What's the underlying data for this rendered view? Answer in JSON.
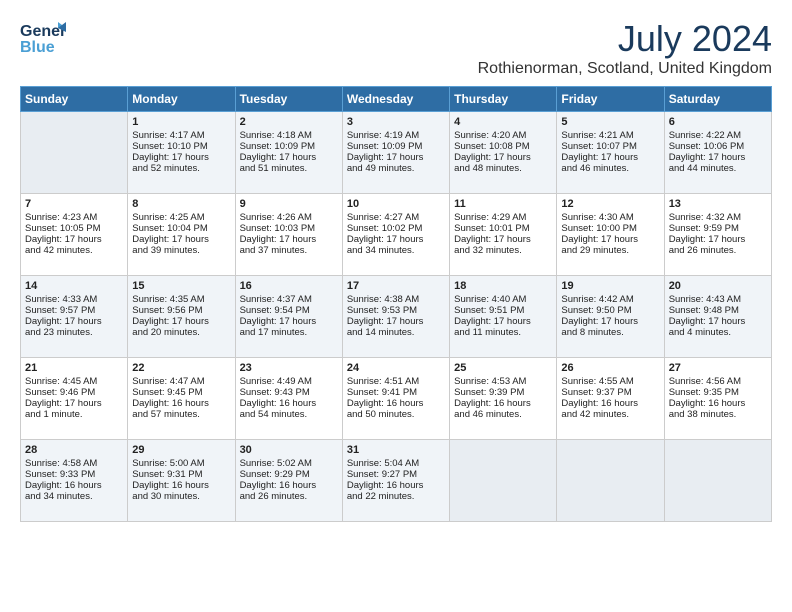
{
  "logo": {
    "line1": "General",
    "line2": "Blue"
  },
  "title": "July 2024",
  "location": "Rothienorman, Scotland, United Kingdom",
  "headers": [
    "Sunday",
    "Monday",
    "Tuesday",
    "Wednesday",
    "Thursday",
    "Friday",
    "Saturday"
  ],
  "weeks": [
    [
      {
        "day": "",
        "lines": []
      },
      {
        "day": "1",
        "lines": [
          "Sunrise: 4:17 AM",
          "Sunset: 10:10 PM",
          "Daylight: 17 hours",
          "and 52 minutes."
        ]
      },
      {
        "day": "2",
        "lines": [
          "Sunrise: 4:18 AM",
          "Sunset: 10:09 PM",
          "Daylight: 17 hours",
          "and 51 minutes."
        ]
      },
      {
        "day": "3",
        "lines": [
          "Sunrise: 4:19 AM",
          "Sunset: 10:09 PM",
          "Daylight: 17 hours",
          "and 49 minutes."
        ]
      },
      {
        "day": "4",
        "lines": [
          "Sunrise: 4:20 AM",
          "Sunset: 10:08 PM",
          "Daylight: 17 hours",
          "and 48 minutes."
        ]
      },
      {
        "day": "5",
        "lines": [
          "Sunrise: 4:21 AM",
          "Sunset: 10:07 PM",
          "Daylight: 17 hours",
          "and 46 minutes."
        ]
      },
      {
        "day": "6",
        "lines": [
          "Sunrise: 4:22 AM",
          "Sunset: 10:06 PM",
          "Daylight: 17 hours",
          "and 44 minutes."
        ]
      }
    ],
    [
      {
        "day": "7",
        "lines": [
          "Sunrise: 4:23 AM",
          "Sunset: 10:05 PM",
          "Daylight: 17 hours",
          "and 42 minutes."
        ]
      },
      {
        "day": "8",
        "lines": [
          "Sunrise: 4:25 AM",
          "Sunset: 10:04 PM",
          "Daylight: 17 hours",
          "and 39 minutes."
        ]
      },
      {
        "day": "9",
        "lines": [
          "Sunrise: 4:26 AM",
          "Sunset: 10:03 PM",
          "Daylight: 17 hours",
          "and 37 minutes."
        ]
      },
      {
        "day": "10",
        "lines": [
          "Sunrise: 4:27 AM",
          "Sunset: 10:02 PM",
          "Daylight: 17 hours",
          "and 34 minutes."
        ]
      },
      {
        "day": "11",
        "lines": [
          "Sunrise: 4:29 AM",
          "Sunset: 10:01 PM",
          "Daylight: 17 hours",
          "and 32 minutes."
        ]
      },
      {
        "day": "12",
        "lines": [
          "Sunrise: 4:30 AM",
          "Sunset: 10:00 PM",
          "Daylight: 17 hours",
          "and 29 minutes."
        ]
      },
      {
        "day": "13",
        "lines": [
          "Sunrise: 4:32 AM",
          "Sunset: 9:59 PM",
          "Daylight: 17 hours",
          "and 26 minutes."
        ]
      }
    ],
    [
      {
        "day": "14",
        "lines": [
          "Sunrise: 4:33 AM",
          "Sunset: 9:57 PM",
          "Daylight: 17 hours",
          "and 23 minutes."
        ]
      },
      {
        "day": "15",
        "lines": [
          "Sunrise: 4:35 AM",
          "Sunset: 9:56 PM",
          "Daylight: 17 hours",
          "and 20 minutes."
        ]
      },
      {
        "day": "16",
        "lines": [
          "Sunrise: 4:37 AM",
          "Sunset: 9:54 PM",
          "Daylight: 17 hours",
          "and 17 minutes."
        ]
      },
      {
        "day": "17",
        "lines": [
          "Sunrise: 4:38 AM",
          "Sunset: 9:53 PM",
          "Daylight: 17 hours",
          "and 14 minutes."
        ]
      },
      {
        "day": "18",
        "lines": [
          "Sunrise: 4:40 AM",
          "Sunset: 9:51 PM",
          "Daylight: 17 hours",
          "and 11 minutes."
        ]
      },
      {
        "day": "19",
        "lines": [
          "Sunrise: 4:42 AM",
          "Sunset: 9:50 PM",
          "Daylight: 17 hours",
          "and 8 minutes."
        ]
      },
      {
        "day": "20",
        "lines": [
          "Sunrise: 4:43 AM",
          "Sunset: 9:48 PM",
          "Daylight: 17 hours",
          "and 4 minutes."
        ]
      }
    ],
    [
      {
        "day": "21",
        "lines": [
          "Sunrise: 4:45 AM",
          "Sunset: 9:46 PM",
          "Daylight: 17 hours",
          "and 1 minute."
        ]
      },
      {
        "day": "22",
        "lines": [
          "Sunrise: 4:47 AM",
          "Sunset: 9:45 PM",
          "Daylight: 16 hours",
          "and 57 minutes."
        ]
      },
      {
        "day": "23",
        "lines": [
          "Sunrise: 4:49 AM",
          "Sunset: 9:43 PM",
          "Daylight: 16 hours",
          "and 54 minutes."
        ]
      },
      {
        "day": "24",
        "lines": [
          "Sunrise: 4:51 AM",
          "Sunset: 9:41 PM",
          "Daylight: 16 hours",
          "and 50 minutes."
        ]
      },
      {
        "day": "25",
        "lines": [
          "Sunrise: 4:53 AM",
          "Sunset: 9:39 PM",
          "Daylight: 16 hours",
          "and 46 minutes."
        ]
      },
      {
        "day": "26",
        "lines": [
          "Sunrise: 4:55 AM",
          "Sunset: 9:37 PM",
          "Daylight: 16 hours",
          "and 42 minutes."
        ]
      },
      {
        "day": "27",
        "lines": [
          "Sunrise: 4:56 AM",
          "Sunset: 9:35 PM",
          "Daylight: 16 hours",
          "and 38 minutes."
        ]
      }
    ],
    [
      {
        "day": "28",
        "lines": [
          "Sunrise: 4:58 AM",
          "Sunset: 9:33 PM",
          "Daylight: 16 hours",
          "and 34 minutes."
        ]
      },
      {
        "day": "29",
        "lines": [
          "Sunrise: 5:00 AM",
          "Sunset: 9:31 PM",
          "Daylight: 16 hours",
          "and 30 minutes."
        ]
      },
      {
        "day": "30",
        "lines": [
          "Sunrise: 5:02 AM",
          "Sunset: 9:29 PM",
          "Daylight: 16 hours",
          "and 26 minutes."
        ]
      },
      {
        "day": "31",
        "lines": [
          "Sunrise: 5:04 AM",
          "Sunset: 9:27 PM",
          "Daylight: 16 hours",
          "and 22 minutes."
        ]
      },
      {
        "day": "",
        "lines": []
      },
      {
        "day": "",
        "lines": []
      },
      {
        "day": "",
        "lines": []
      }
    ]
  ]
}
